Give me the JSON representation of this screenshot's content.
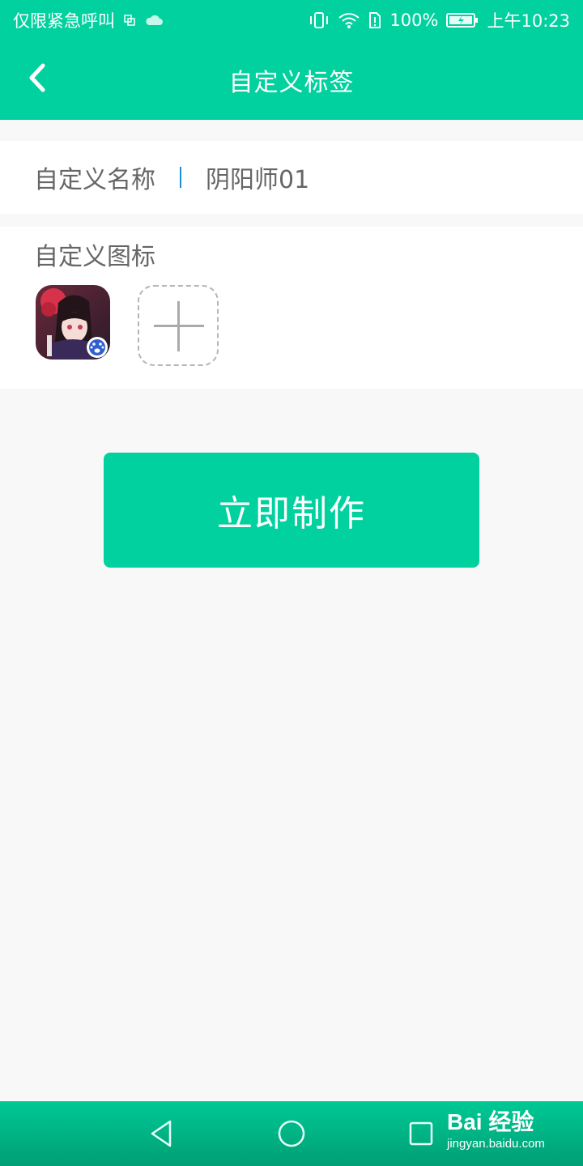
{
  "status_bar": {
    "carrier_text": "仅限紧急呼叫",
    "battery": "100%",
    "time": "上午10:23",
    "icons": [
      "sim-icon",
      "cloud-icon",
      "vibrate-icon",
      "wifi-icon",
      "no-sim-icon",
      "battery-icon"
    ]
  },
  "app_bar": {
    "title": "自定义标签",
    "back_icon": "chevron-left-icon"
  },
  "name_field": {
    "label": "自定义名称",
    "value": "阴阳师01"
  },
  "icon_field": {
    "label": "自定义图标",
    "selected_icon": "app-icon-onmyoji",
    "add_icon": "add-icon"
  },
  "action": {
    "make_label": "立即制作"
  },
  "nav_bar": {
    "icons": [
      "back-triangle-icon",
      "home-circle-icon",
      "recents-square-icon"
    ]
  },
  "watermark": {
    "logo": "Bai 经验",
    "url": "jingyan.baidu.com"
  },
  "colors": {
    "primary": "#00d19f",
    "background": "#f8f8f8",
    "text": "#666666",
    "divider": "#1a8fd6"
  }
}
